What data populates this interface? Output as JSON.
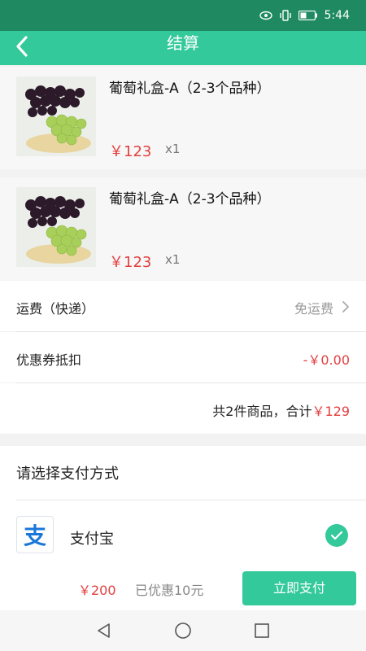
{
  "status_bar": {
    "time": "5:44",
    "icons": [
      "eye-icon",
      "vibrate-icon",
      "battery-icon"
    ]
  },
  "header": {
    "title": "结算",
    "back_icon": "chevron-left-icon"
  },
  "products": [
    {
      "name": "葡萄礼盒-A（2-3个品种）",
      "price": "￥123",
      "quantity": "x1",
      "image": "grapes-photo"
    },
    {
      "name": "葡萄礼盒-A（2-3个品种）",
      "price": "￥123",
      "quantity": "x1",
      "image": "grapes-photo"
    }
  ],
  "shipping": {
    "label": "运费（快递）",
    "value": "免运费"
  },
  "coupon": {
    "label": "优惠券抵扣",
    "value": "-￥0.00"
  },
  "summary": {
    "text": "共2件商品，合计",
    "amount": "￥129"
  },
  "payment": {
    "title": "请选择支付方式",
    "method": {
      "name": "支付宝",
      "logo_char": "支",
      "selected": true
    }
  },
  "footer": {
    "total": "￥200",
    "discount": "已优惠10元",
    "pay_button": "立即支付"
  },
  "colors": {
    "status_bar": "#1f8a62",
    "primary": "#33c99a",
    "price_red": "#e24040",
    "alipay_blue": "#1a77d9"
  }
}
